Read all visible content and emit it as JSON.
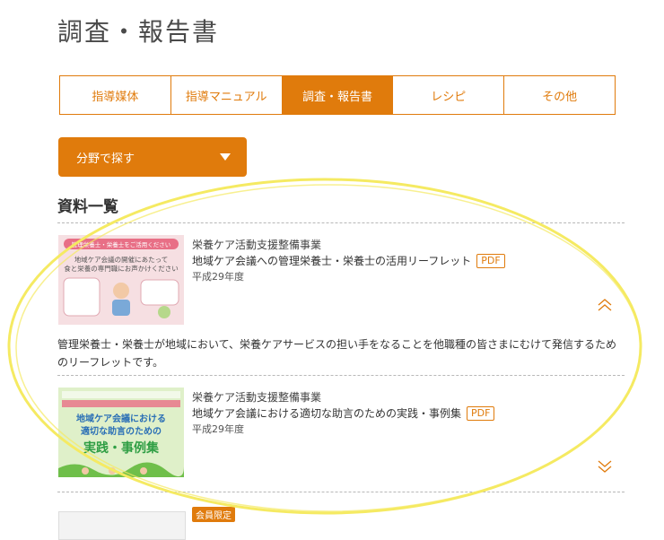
{
  "page": {
    "title": "調査・報告書"
  },
  "tabs": [
    {
      "label": "指導媒体",
      "active": false
    },
    {
      "label": "指導マニュアル",
      "active": false
    },
    {
      "label": "調査・報告書",
      "active": true
    },
    {
      "label": "レシピ",
      "active": false
    },
    {
      "label": "その他",
      "active": false
    }
  ],
  "filter": {
    "label": "分野で探す",
    "icon": "caret-down-icon"
  },
  "section": {
    "title": "資料一覧"
  },
  "items": [
    {
      "category": "栄養ケア活動支援整備事業",
      "title": "地域ケア会議への管理栄養士・栄養士の活用リーフレット",
      "badge": "PDF",
      "year": "平成29年度",
      "thumbnail_text": {
        "banner": "管理栄養士・栄養士をご活用ください",
        "line1": "地域ケア会議の開催にあたって",
        "line2": "食と栄養の専門職にお声かけください"
      },
      "toggle_icon": "chevron-up-icon",
      "description": "管理栄養士・栄養士が地域において、栄養ケアサービスの担い手をなることを他職種の皆さまにむけて発信するためのリーフレットです。"
    },
    {
      "category": "栄養ケア活動支援整備事業",
      "title": "地域ケア会議における適切な助言のための実践・事例集",
      "badge": "PDF",
      "year": "平成29年度",
      "thumbnail_text": {
        "line1": "地域ケア会議における",
        "line2": "適切な助言のための",
        "line3": "実践・事例集"
      },
      "toggle_icon": "chevron-down-icon"
    },
    {
      "badge": "会員限定"
    }
  ],
  "colors": {
    "accent": "#e07b0c",
    "annotation": "#f5ea62"
  }
}
